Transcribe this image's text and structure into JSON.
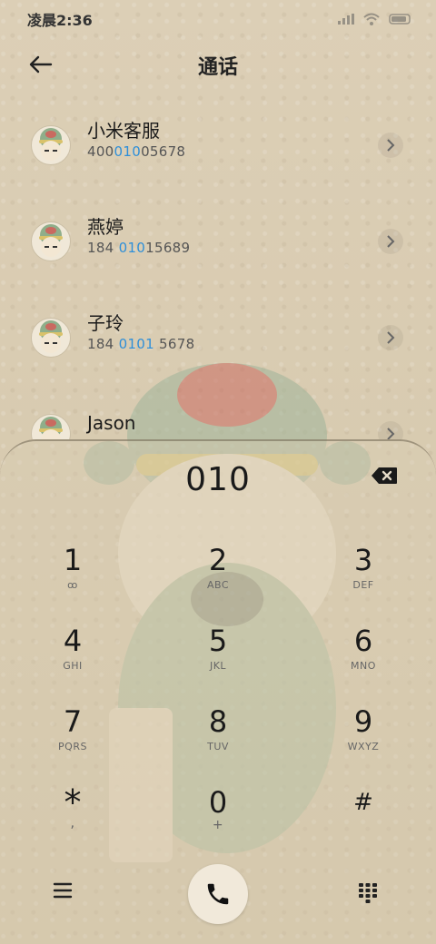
{
  "status": {
    "time": "凌晨2:36"
  },
  "header": {
    "title": "通话"
  },
  "contacts": [
    {
      "name": "小米客服",
      "num_pre": "400",
      "num_hl": "010",
      "num_post": "05678"
    },
    {
      "name": "燕婷",
      "num_pre": "184 ",
      "num_hl": "010",
      "num_post": "15689"
    },
    {
      "name": "子玲",
      "num_pre": "184 ",
      "num_hl": "0101",
      "num_post": " 5678"
    },
    {
      "name": "Jason",
      "num_pre": "",
      "num_hl": "",
      "num_post": ""
    }
  ],
  "dialpad": {
    "display": "010",
    "keys": [
      {
        "digit": "1",
        "letters": "ꝏ"
      },
      {
        "digit": "2",
        "letters": "ABC"
      },
      {
        "digit": "3",
        "letters": "DEF"
      },
      {
        "digit": "4",
        "letters": "GHI"
      },
      {
        "digit": "5",
        "letters": "JKL"
      },
      {
        "digit": "6",
        "letters": "MNO"
      },
      {
        "digit": "7",
        "letters": "PQRS"
      },
      {
        "digit": "8",
        "letters": "TUV"
      },
      {
        "digit": "9",
        "letters": "WXYZ"
      },
      {
        "digit": "*",
        "letters": ","
      },
      {
        "digit": "0",
        "letters": "+"
      },
      {
        "digit": "#",
        "letters": ""
      }
    ]
  },
  "colors": {
    "highlight": "#2f8fd8",
    "background": "#d9cdb4"
  },
  "icons": [
    "back-arrow-icon",
    "backspace-icon",
    "menu-icon",
    "phone-icon",
    "keypad-icon",
    "chevron-right-icon",
    "voicemail-icon"
  ]
}
